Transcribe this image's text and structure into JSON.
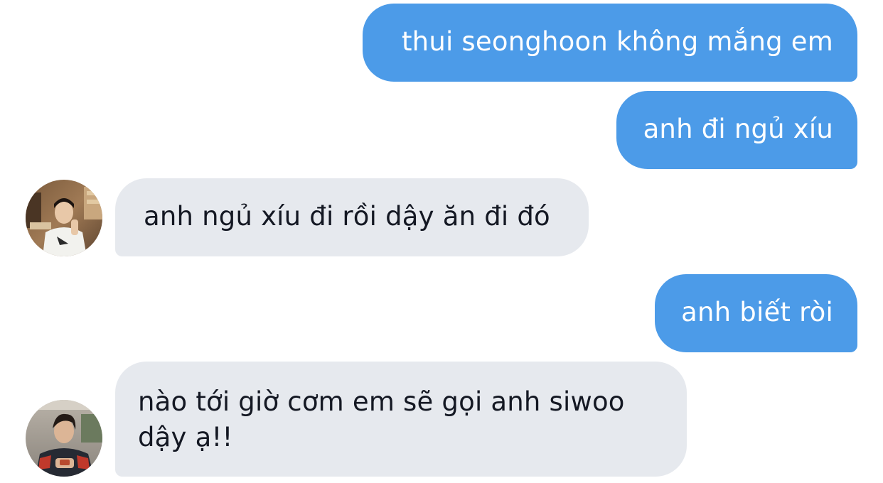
{
  "conversation": {
    "messages": [
      {
        "direction": "sent",
        "text": "thui seonghoon không mắng em"
      },
      {
        "direction": "sent",
        "text": "anh đi ngủ xíu"
      },
      {
        "direction": "received",
        "text": "anh ngủ xíu đi rồi dậy ăn đi đó",
        "avatar": "user-avatar-photo-1"
      },
      {
        "direction": "sent",
        "text": "anh biết ròi"
      },
      {
        "direction": "received",
        "text": "nào tới giờ cơm em sẽ gọi anh siwoo dậy ạ!!",
        "avatar": "user-avatar-photo-2"
      }
    ]
  },
  "colors": {
    "sent_bubble": "#4c9be8",
    "received_bubble": "#e6e9ee",
    "sent_text": "#ffffff",
    "received_text": "#141823",
    "background": "#ffffff"
  }
}
